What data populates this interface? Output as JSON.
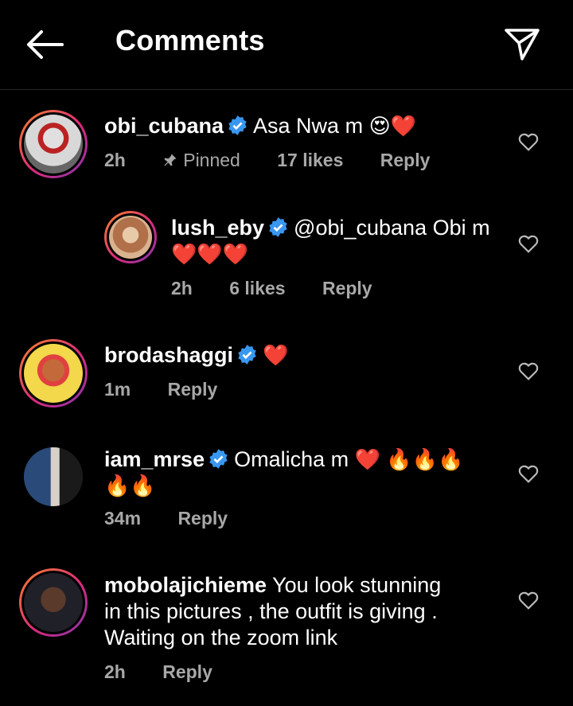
{
  "header": {
    "title": "Comments",
    "back_icon": "arrow-left-icon",
    "share_icon": "send-icon"
  },
  "comments": [
    {
      "username": "obi_cubana",
      "verified": true,
      "text": "Asa Nwa m",
      "emojis": "😍❤️",
      "time": "2h",
      "pinned_label": "Pinned",
      "likes": "17 likes",
      "reply": "Reply"
    },
    {
      "username": "lush_eby",
      "verified": true,
      "text": "@obi_cubana Obi m",
      "emojis": "❤️❤️❤️",
      "time": "2h",
      "likes": "6 likes",
      "reply": "Reply"
    },
    {
      "username": "brodashaggi",
      "verified": true,
      "emojis": "❤️",
      "time": "1m",
      "reply": "Reply"
    },
    {
      "username": "iam_mrse",
      "verified": true,
      "text": "Omalicha m",
      "emojis": "❤️ 🔥🔥🔥",
      "emojis2": "🔥🔥",
      "time": "34m",
      "reply": "Reply"
    },
    {
      "username": "mobolajichieme",
      "verified": false,
      "text_line1": "You look stunning",
      "text_line2": "in this pictures , the outfit is giving .",
      "text_line3": "Waiting on the zoom link",
      "time": "2h",
      "reply": "Reply"
    }
  ],
  "colors": {
    "background": "#000000",
    "text": "#ffffff",
    "muted": "#a8a8a8",
    "verified": "#3897f0"
  }
}
